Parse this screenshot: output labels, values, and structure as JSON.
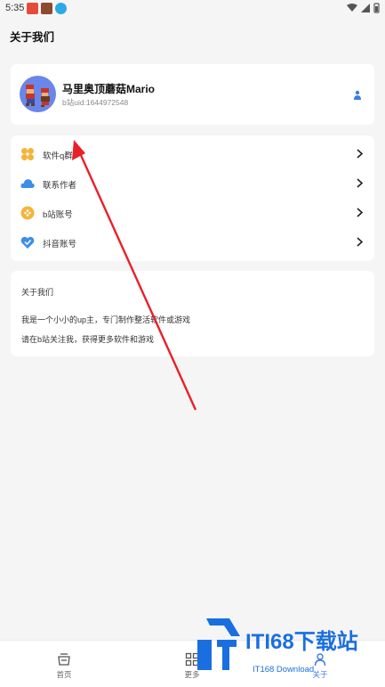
{
  "status_bar": {
    "time": "5:35"
  },
  "header": {
    "title": "关于我们"
  },
  "profile": {
    "name": "马里奥顶蘑菇Mario",
    "uid": "b站uid:1644972548"
  },
  "menu": {
    "items": [
      {
        "label": "软件q群",
        "icon": "clover-icon",
        "color": "#f4b43a"
      },
      {
        "label": "联系作者",
        "icon": "cloud-icon",
        "color": "#3d8ee6"
      },
      {
        "label": "b站账号",
        "icon": "gamepad-icon",
        "color": "#f4b43a"
      },
      {
        "label": "抖音账号",
        "icon": "heart-shield-icon",
        "color": "#3d8ee6"
      }
    ]
  },
  "about": {
    "title": "关于我们",
    "line1": "我是一个小小的up主，专门制作整活软件或游戏",
    "line2": "请在b站关注我，获得更多软件和游戏"
  },
  "tabbar": {
    "tabs": [
      {
        "label": "首页",
        "active": false
      },
      {
        "label": "更多",
        "active": false
      },
      {
        "label": "关于",
        "active": true
      }
    ]
  },
  "watermark": {
    "logo_text": "ITI68下载站",
    "sub_text": "IT168 Download"
  },
  "colors": {
    "accent": "#3c7be6",
    "arrow": "#e8202a",
    "background": "#f5f5f5"
  }
}
